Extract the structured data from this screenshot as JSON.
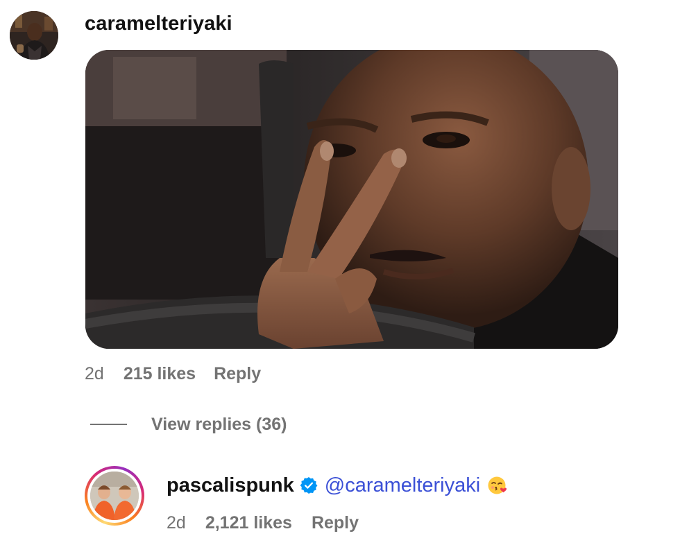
{
  "comments": [
    {
      "username": "caramelteriyaki",
      "media": "photo of a man in a car making a two-finger gesture near his eye",
      "time": "2d",
      "likes": "215 likes",
      "reply_label": "Reply",
      "view_replies": "View replies (36)"
    },
    {
      "username": "pascalispunk",
      "verified": true,
      "mention": "@caramelteriyaki",
      "emoji": "face-blowing-a-kiss",
      "time": "2d",
      "likes": "2,121 likes",
      "reply_label": "Reply"
    }
  ],
  "colors": {
    "text_primary": "#121212",
    "text_secondary": "#737373",
    "mention": "#3b50d6",
    "verified": "#0095f6"
  }
}
